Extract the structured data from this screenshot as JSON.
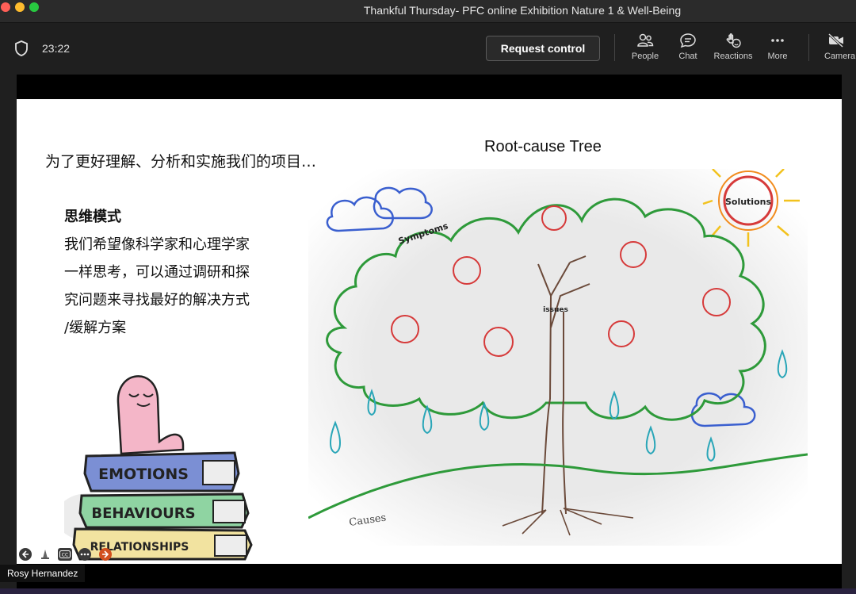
{
  "window": {
    "title": "Thankful Thursday- PFC online Exhibition Nature 1 & Well-Being"
  },
  "toolbar": {
    "timer": "23:22",
    "request_control_label": "Request control",
    "items": [
      {
        "label": "People",
        "icon": "people-icon"
      },
      {
        "label": "Chat",
        "icon": "chat-icon"
      },
      {
        "label": "Reactions",
        "icon": "reactions-icon"
      },
      {
        "label": "More",
        "icon": "more-icon"
      },
      {
        "label": "Camera",
        "icon": "camera-off-icon"
      }
    ]
  },
  "slide": {
    "heading": "为了更好理解、分析和实施我们的项目…",
    "mindset_title": "思维模式",
    "mindset_lines": [
      "我们希望像科学家和心理学家",
      "一样思考，可以通过调研和探",
      "究问题来寻找最好的解决方式",
      "/缓解方案"
    ],
    "tree_title": "Root-cause Tree",
    "tree_labels": {
      "symptoms": "Symptoms",
      "solutions": "Solutions",
      "issues": "issues",
      "causes": "Causes"
    },
    "books": [
      "EMOTIONS",
      "BEHAVIOURS",
      "RELATIONSHIPS"
    ]
  },
  "participant": {
    "name": "Rosy Hernandez"
  },
  "colors": {
    "titlebar": "#2b2b2b",
    "toolbar": "#1f1f1f",
    "tree_green": "#2e9a3a",
    "apple_red": "#d63a3a",
    "rain_teal": "#2aa6b8",
    "sun_orange": "#f28c1e"
  }
}
